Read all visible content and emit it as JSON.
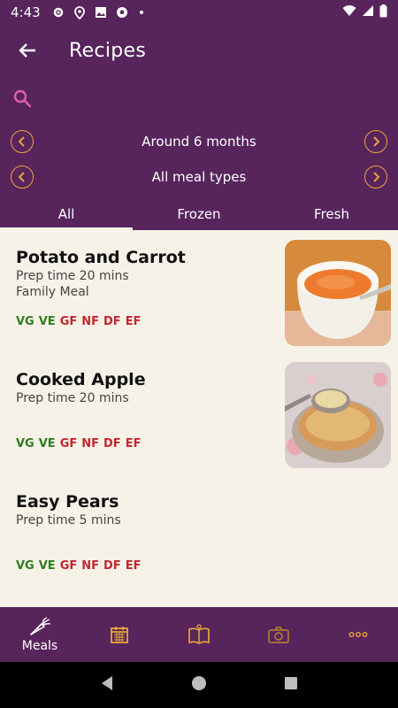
{
  "status_bar": {
    "time": "4:43"
  },
  "header": {
    "title": "Recipes"
  },
  "filters": {
    "age": "Around 6 months",
    "meal_type": "All meal types"
  },
  "tabs": [
    {
      "label": "All",
      "active": true
    },
    {
      "label": "Frozen",
      "active": false
    },
    {
      "label": "Fresh",
      "active": false
    }
  ],
  "recipes": [
    {
      "name": "Potato and Carrot",
      "prep": "Prep time 20 mins",
      "meal": "Family Meal",
      "tags": [
        "VG",
        "VE",
        "GF",
        "NF",
        "DF",
        "EF"
      ],
      "thumbnail": "puree-ramekin"
    },
    {
      "name": "Cooked Apple",
      "prep": "Prep time 20 mins",
      "meal": "",
      "tags": [
        "VG",
        "VE",
        "GF",
        "NF",
        "DF",
        "EF"
      ],
      "thumbnail": "apple-spoon"
    },
    {
      "name": "Easy Pears",
      "prep": "Prep time 5 mins",
      "meal": "",
      "tags": [
        "VG",
        "VE",
        "GF",
        "NF",
        "DF",
        "EF"
      ],
      "thumbnail": ""
    }
  ],
  "bottom_nav": [
    {
      "label": "Meals",
      "icon": "carrot-icon",
      "active": true
    },
    {
      "label": "",
      "icon": "calendar-icon"
    },
    {
      "label": "",
      "icon": "book-icon"
    },
    {
      "label": "",
      "icon": "camera-icon"
    },
    {
      "label": "",
      "icon": "more-icon"
    }
  ],
  "colors": {
    "primary": "#57245c",
    "accent": "#e9a53a",
    "background": "#f7f2e8",
    "tag_green": "#2e7d1e",
    "tag_red": "#c1272d"
  }
}
